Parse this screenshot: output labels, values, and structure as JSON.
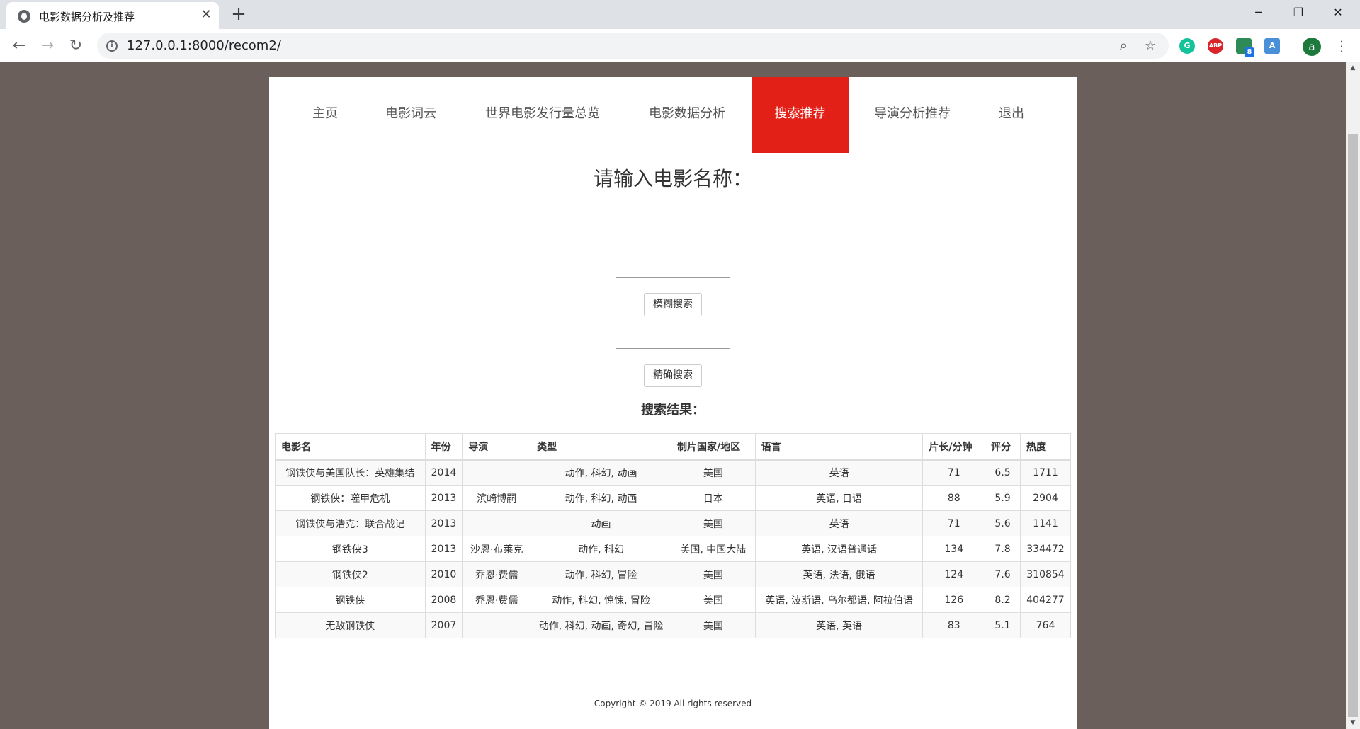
{
  "browser": {
    "tab_title": "电影数据分析及推荐",
    "tab_close": "✕",
    "new_tab": "+",
    "url": "127.0.0.1:8000/recom2/",
    "window_controls": {
      "minimize": "─",
      "maximize": "❐",
      "close": "✕"
    },
    "extensions": [
      "grammarly-icon",
      "adblock-icon",
      "sheets-icon",
      "translate-icon"
    ],
    "extension_badge": "8",
    "abp_label": "ABP",
    "profile_initial": "a"
  },
  "nav": {
    "items": [
      {
        "label": "主页"
      },
      {
        "label": "电影词云"
      },
      {
        "label": "世界电影发行量总览"
      },
      {
        "label": "电影数据分析"
      },
      {
        "label": "搜索推荐"
      },
      {
        "label": "导演分析推荐"
      },
      {
        "label": "退出"
      }
    ],
    "active": "搜索推荐"
  },
  "search": {
    "prompt": "请输入电影名称：",
    "fuzzy_value": "",
    "fuzzy_button": "模糊搜索",
    "exact_value": "",
    "exact_button": "精确搜索",
    "results_title": "搜索结果："
  },
  "table": {
    "headers": [
      "电影名",
      "年份",
      "导演",
      "类型",
      "制片国家/地区",
      "语言",
      "片长/分钟",
      "评分",
      "热度"
    ],
    "rows": [
      [
        "钢铁侠与美国队长：英雄集结",
        "2014",
        "",
        "动作, 科幻, 动画",
        "美国",
        "英语",
        "71",
        "6.5",
        "1711"
      ],
      [
        "钢铁侠：噬甲危机",
        "2013",
        "滨崎博嗣",
        "动作, 科幻, 动画",
        "日本",
        "英语, 日语",
        "88",
        "5.9",
        "2904"
      ],
      [
        "钢铁侠与浩克：联合战记",
        "2013",
        "",
        "动画",
        "美国",
        "英语",
        "71",
        "5.6",
        "1141"
      ],
      [
        "钢铁侠3",
        "2013",
        "沙恩·布莱克",
        "动作, 科幻",
        "美国, 中国大陆",
        "英语, 汉语普通话",
        "134",
        "7.8",
        "334472"
      ],
      [
        "钢铁侠2",
        "2010",
        "乔恩·费儒",
        "动作, 科幻, 冒险",
        "美国",
        "英语, 法语, 俄语",
        "124",
        "7.6",
        "310854"
      ],
      [
        "钢铁侠",
        "2008",
        "乔恩·费儒",
        "动作, 科幻, 惊悚, 冒险",
        "美国",
        "英语, 波斯语, 乌尔都语, 阿拉伯语",
        "126",
        "8.2",
        "404277"
      ],
      [
        "无敌钢铁侠",
        "2007",
        "",
        "动作, 科幻, 动画, 奇幻, 冒险",
        "美国",
        "英语, 英语",
        "83",
        "5.1",
        "764"
      ]
    ]
  },
  "footer": {
    "copyright": "Copyright © 2019 All rights reserved"
  },
  "colors": {
    "accent": "#e32017",
    "page_bg": "#6a5f5b"
  }
}
